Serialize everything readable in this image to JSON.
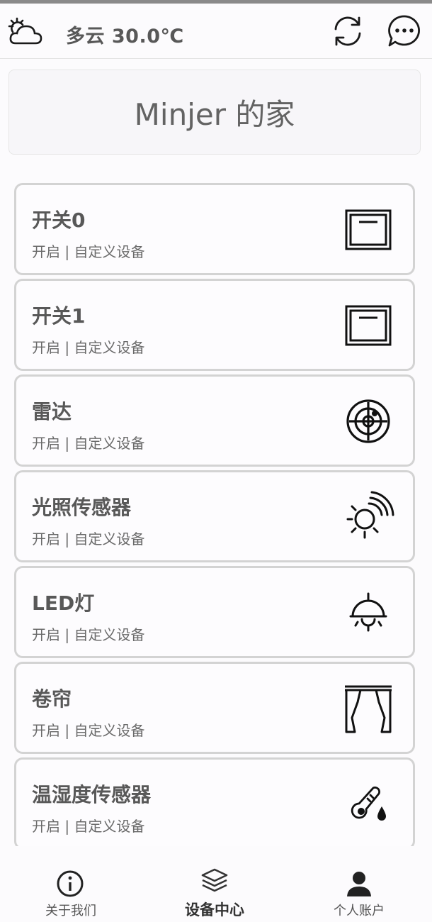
{
  "header": {
    "weather_icon": "partly-cloudy-icon",
    "weather": "多云 30.0℃",
    "refresh_icon": "refresh-icon",
    "chat_icon": "chat-bubble-icon"
  },
  "home": {
    "title": "Minjer 的家"
  },
  "devices": [
    {
      "name": "开关0",
      "status": "开启 | 自定义设备",
      "icon": "switch-icon"
    },
    {
      "name": "开关1",
      "status": "开启 | 自定义设备",
      "icon": "switch-icon"
    },
    {
      "name": "雷达",
      "status": "开启 | 自定义设备",
      "icon": "radar-icon"
    },
    {
      "name": "光照传感器",
      "status": "开启 | 自定义设备",
      "icon": "light-sensor-icon"
    },
    {
      "name": "LED灯",
      "status": "开启 | 自定义设备",
      "icon": "lamp-icon"
    },
    {
      "name": "卷帘",
      "status": "开启 | 自定义设备",
      "icon": "curtain-icon"
    },
    {
      "name": "温湿度传感器",
      "status": "开启 | 自定义设备",
      "icon": "thermometer-humidity-icon"
    }
  ],
  "nav": {
    "items": [
      {
        "label": "关于我们",
        "icon": "info-icon",
        "active": false
      },
      {
        "label": "设备中心",
        "icon": "layers-icon",
        "active": true
      },
      {
        "label": "个人账户",
        "icon": "user-icon",
        "active": false
      }
    ]
  },
  "colors": {
    "background": "#fcfbfd",
    "card_border": "#d3d3d3",
    "text_primary": "#585858",
    "text_secondary": "#6a6a6a"
  }
}
